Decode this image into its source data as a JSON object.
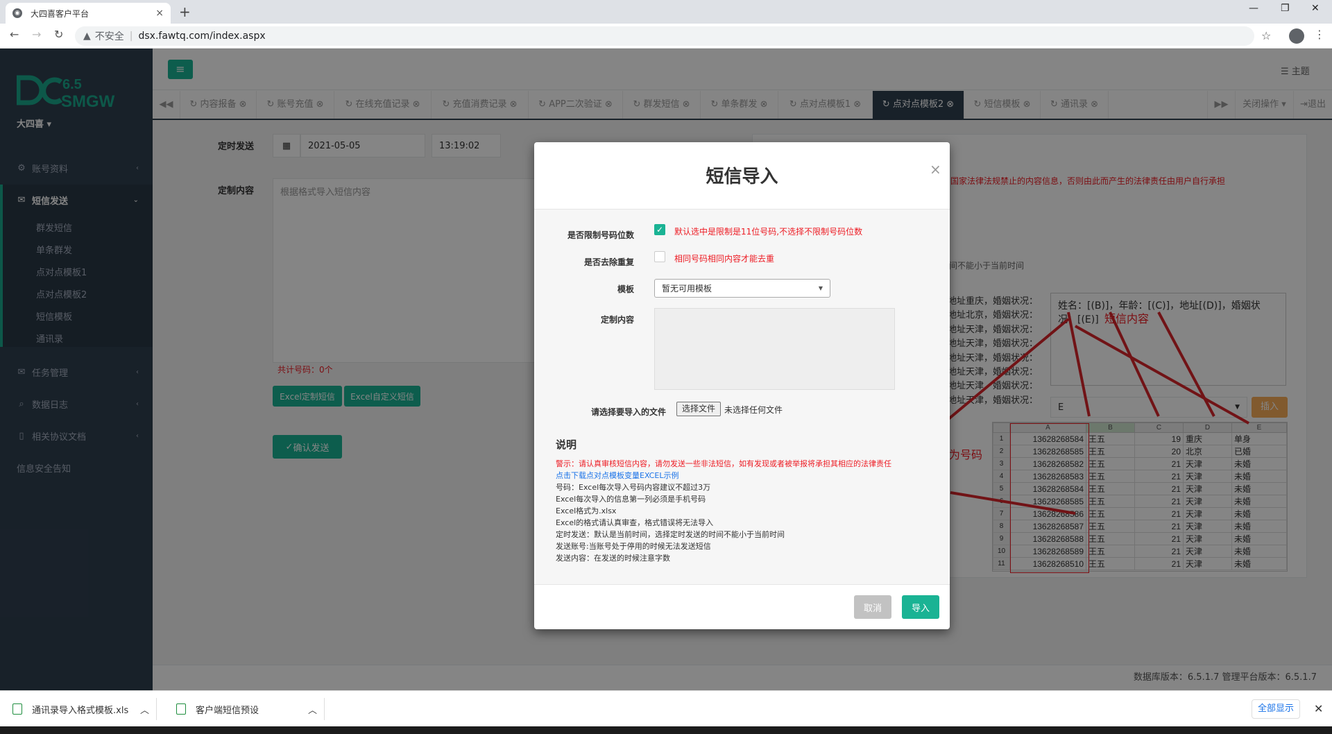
{
  "browser": {
    "tab_title": "大四喜客户平台",
    "tab_close": "×",
    "new_tab": "+",
    "insecure_label": "不安全",
    "url": "dsx.fawtq.com/index.aspx",
    "win_min": "—",
    "win_max": "❐",
    "win_close": "✕"
  },
  "sidebar": {
    "logo_top": "6.5",
    "logo_bottom": "SMGW",
    "user": "大四喜",
    "menu": [
      {
        "label": "账号资料"
      },
      {
        "label": "短信发送"
      },
      {
        "label": "任务管理"
      },
      {
        "label": "数据日志"
      },
      {
        "label": "相关协议文档"
      },
      {
        "label": "信息安全告知"
      }
    ],
    "submenu": [
      "群发短信",
      "单条群发",
      "点对点模板1",
      "点对点模板2",
      "短信模板",
      "通讯录"
    ]
  },
  "header": {
    "theme": "主题"
  },
  "tabs": {
    "items": [
      {
        "label": "内容报备"
      },
      {
        "label": "账号充值"
      },
      {
        "label": "在线充值记录"
      },
      {
        "label": "充值消费记录"
      },
      {
        "label": "APP二次验证"
      },
      {
        "label": "群发短信"
      },
      {
        "label": "单条群发"
      },
      {
        "label": "点对点模板1"
      },
      {
        "label": "点对点模板2"
      },
      {
        "label": "短信模板"
      },
      {
        "label": "通讯录"
      }
    ],
    "active_index": 8,
    "close_ops": "关闭操作",
    "logout": "退出"
  },
  "page": {
    "schedule_label": "定时发送",
    "date_value": "2021-05-05",
    "time_value": "13:19:02",
    "content_label": "定制内容",
    "content_placeholder": "根据格式导入短信内容",
    "count_text": "共计号码：0个",
    "excel_btn1": "Excel定制短信",
    "excel_btn2": "Excel自定义短信",
    "confirm_btn": "确认发送",
    "right_warning": "国家法律法规禁止的内容信息，否则由此而产生的法律责任由用户自行承担",
    "right_time_note": "间不能小于当前时间",
    "template_text": "姓名：[(B)]，年龄：[(C)]，地址[(D)]，婚姻状况：[(E)]",
    "annotation_content": "短信内容",
    "annotation_phone": "必须为号码",
    "field_value": "E",
    "insert_btn": "插入",
    "left_lines": [
      "地址重庆，婚姻状况：",
      "地址北京，婚姻状况：",
      "地址天津，婚姻状况：",
      "地址天津，婚姻状况：",
      "地址天津，婚姻状况：",
      "地址天津，婚姻状况：",
      "地址天津，婚姻状况：",
      "地址天津，婚姻状况："
    ],
    "sheet_cols": [
      "A",
      "B",
      "C",
      "D",
      "E"
    ],
    "sheet_rows": [
      [
        "1",
        "13628268584",
        "王五",
        "19",
        "重庆",
        "单身"
      ],
      [
        "2",
        "13628268585",
        "王五",
        "20",
        "北京",
        "已婚"
      ],
      [
        "3",
        "13628268582",
        "王五",
        "21",
        "天津",
        "未婚"
      ],
      [
        "4",
        "13628268583",
        "王五",
        "21",
        "天津",
        "未婚"
      ],
      [
        "5",
        "13628268584",
        "王五",
        "21",
        "天津",
        "未婚"
      ],
      [
        "6",
        "13628268585",
        "王五",
        "21",
        "天津",
        "未婚"
      ],
      [
        "7",
        "13628268586",
        "王五",
        "21",
        "天津",
        "未婚"
      ],
      [
        "8",
        "13628268587",
        "王五",
        "21",
        "天津",
        "未婚"
      ],
      [
        "9",
        "13628268588",
        "王五",
        "21",
        "天津",
        "未婚"
      ],
      [
        "10",
        "13628268589",
        "王五",
        "21",
        "天津",
        "未婚"
      ],
      [
        "11",
        "13628268510",
        "王五",
        "21",
        "天津",
        "未婚"
      ]
    ]
  },
  "modal": {
    "title": "短信导入",
    "close": "×",
    "limit_label": "是否限制号码位数",
    "limit_note": "默认选中是限制是11位号码,不选择不限制号码位数",
    "dedup_label": "是否去除重复",
    "dedup_note": "相同号码相同内容才能去重",
    "template_label": "模板",
    "template_value": "暂无可用模板",
    "content_label": "定制内容",
    "file_label": "请选择要导入的文件",
    "file_btn": "选择文件",
    "file_none": "未选择任何文件",
    "desc_title": "说明",
    "desc_warning": "警示：请认真审核短信内容，请勿发送一些非法短信，如有发现或者被举报将承担其相应的法律责任",
    "desc_link": "点击下载点对点模板变量EXCEL示例",
    "notes": [
      "号码：Excel每次导入号码内容建议不超过3万",
      "Excel每次导入的信息第一列必须是手机号码",
      "Excel格式为.xlsx",
      "Excel的格式请认真审查，格式错误将无法导入",
      "定时发送：默认是当前时间，选择定时发送的时间不能小于当前时间",
      "发送账号:当账号处于停用的时候无法发送短信",
      "发送内容：在发送的时候注意字数"
    ],
    "cancel": "取消",
    "import": "导入"
  },
  "footer": {
    "version": "数据库版本：6.5.1.7 管理平台版本：6.5.1.7"
  },
  "downloads": {
    "items": [
      "通讯录导入格式模板.xls",
      "客户端短信预设"
    ],
    "show_all": "全部显示"
  },
  "colors": {
    "accent": "#1ab394",
    "sidebar": "#2f4050",
    "warning_red": "#ed1c24"
  }
}
